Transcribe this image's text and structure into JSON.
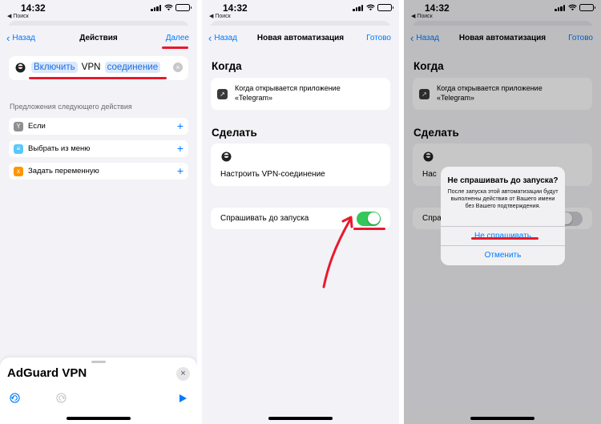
{
  "status": {
    "time": "14:32",
    "back_app": "◀ Поиск"
  },
  "screen1": {
    "nav": {
      "back": "Назад",
      "title": "Действия",
      "next": "Далее"
    },
    "action": {
      "word1": "Включить",
      "word2": "VPN",
      "word3": "соединение"
    },
    "suggestions_title": "Предложения следующего действия",
    "suggestions": [
      {
        "label": "Если",
        "icon": "if-icon",
        "color": "#8e8e93"
      },
      {
        "label": "Выбрать из меню",
        "icon": "menu-icon",
        "color": "#5ac8fa"
      },
      {
        "label": "Задать переменную",
        "icon": "variable-icon",
        "color": "#ff9500"
      }
    ],
    "app_panel": {
      "name": "AdGuard VPN"
    }
  },
  "screen2": {
    "nav": {
      "back": "Назад",
      "title": "Новая автоматизация",
      "done": "Готово"
    },
    "when_header": "Когда",
    "trigger_line1": "Когда открывается приложение",
    "trigger_line2": "«Telegram»",
    "do_header": "Сделать",
    "action_label": "Настроить VPN-соединение",
    "ask_label": "Спрашивать до запуска",
    "ask_toggle_on": true
  },
  "screen3": {
    "nav": {
      "back": "Назад",
      "title": "Новая автоматизация",
      "done": "Готово"
    },
    "when_header": "Когда",
    "trigger_line1": "Когда открывается приложение",
    "trigger_line2": "«Telegram»",
    "do_header": "Сделать",
    "action_partial": "Нас",
    "ask_partial": "Спраш",
    "alert": {
      "title": "Не спрашивать до запуска?",
      "body": "После запуска этой автоматизации будут выполнены действия от Вашего имени без Вашего подтверждения.",
      "confirm": "Не спрашивать",
      "cancel": "Отменить"
    }
  },
  "colors": {
    "accent": "#007aff",
    "highlight": "#e8192c",
    "toggle_on": "#34c759"
  }
}
